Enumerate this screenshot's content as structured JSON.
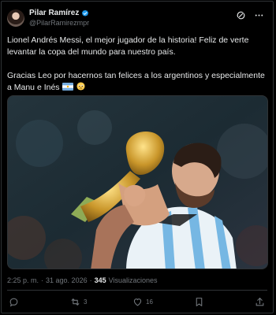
{
  "post": {
    "author": {
      "display_name": "Pilar Ramírez",
      "handle": "@PilarRamirezmpr",
      "verified": true
    },
    "text_paragraphs": [
      "Lionel Andrés Messi, el mejor jugador de la historia! Feliz de verte levantar la copa del mundo para nuestro país.",
      "Gracias Leo por hacernos tan felices a los argentinos y especialmente a Manu e Inés"
    ],
    "emojis": [
      "argentina-flag",
      "pleading-face"
    ],
    "meta": {
      "time": "2:25 p. m.",
      "separator": "·",
      "date": "31 ago. 2026",
      "views_count": "345",
      "views_label": "Visualizaciones"
    },
    "actions": {
      "reply_count": "",
      "repost_count": "3",
      "like_count": "16"
    }
  },
  "colors": {
    "background": "#000000",
    "text": "#e7e9ea",
    "muted": "#71767b",
    "verified_blue": "#1d9bf0",
    "border": "#2f3336"
  }
}
